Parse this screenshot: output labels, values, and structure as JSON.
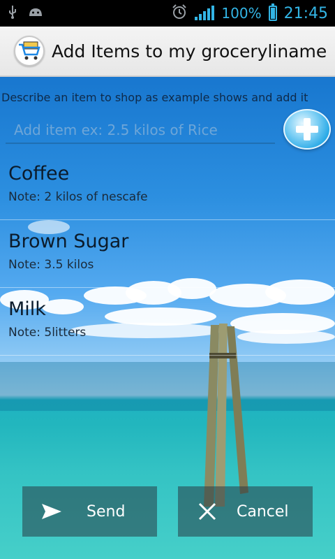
{
  "status_bar": {
    "battery_percent": "100%",
    "time": "21:45",
    "left_icons": [
      "usb-icon",
      "android-icon"
    ],
    "right_icons": [
      "alarm-icon",
      "signal-icon",
      "battery-icon"
    ],
    "accent_color": "#33b5e5"
  },
  "action_bar": {
    "title": "Add Items to my groceryliname",
    "icon": "shopping-cart-icon"
  },
  "form": {
    "description": "Describe an item to shop as example shows and add it",
    "input_placeholder": "Add item ex: 2.5 kilos of Rice",
    "input_value": "",
    "add_button_icon": "plus-icon"
  },
  "items": [
    {
      "name": "Coffee",
      "note": "Note: 2 kilos of nescafe"
    },
    {
      "name": "Brown Sugar",
      "note": "Note: 3.5 kilos"
    },
    {
      "name": "Milk",
      "note": "Note: 5litters"
    }
  ],
  "buttons": {
    "send_label": "Send",
    "send_icon": "send-icon",
    "cancel_label": "Cancel",
    "cancel_icon": "close-icon"
  }
}
